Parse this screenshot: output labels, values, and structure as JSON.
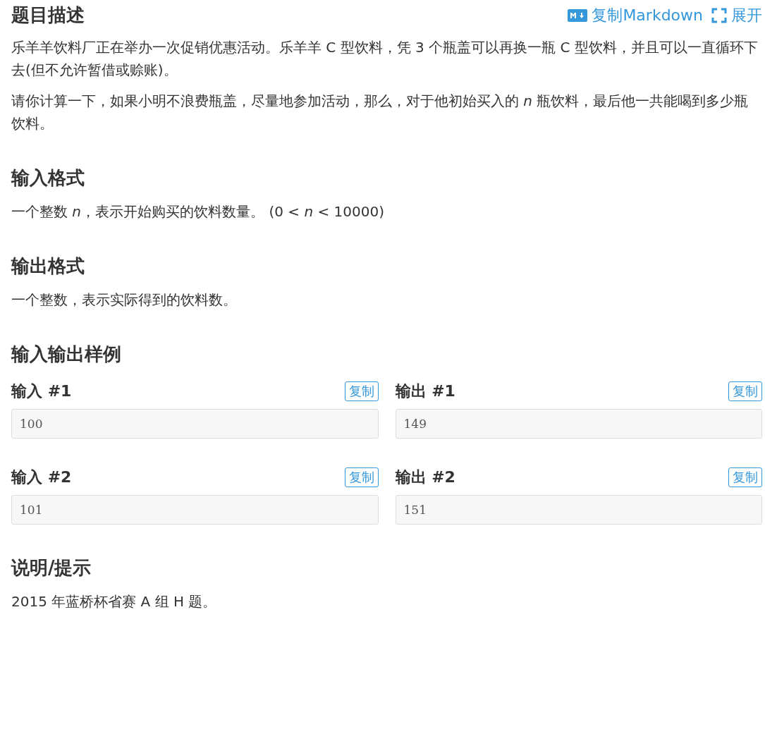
{
  "header": {
    "title": "题目描述",
    "actions": [
      {
        "kind": "markdown",
        "label": "复制Markdown"
      },
      {
        "kind": "expand",
        "label": "展开"
      }
    ]
  },
  "description": [
    "乐羊羊饮料厂正在举办一次促销优惠活动。乐羊羊 C 型饮料，凭 3 个瓶盖可以再换一瓶 C 型饮料，并且可以一直循环下去(但不允许暂借或赊账)。",
    "请你计算一下，如果小明不浪费瓶盖，尽量地参加活动，那么，对于他初始买入的 *n* 瓶饮料，最后他一共能喝到多少瓶饮料。"
  ],
  "input_format": {
    "title": "输入格式",
    "text": "一个整数 *n*，表示开始购买的饮料数量。 (0 < *n* < 10000)"
  },
  "output_format": {
    "title": "输出格式",
    "text": "一个整数，表示实际得到的饮料数。"
  },
  "samples": {
    "title": "输入输出样例",
    "items": [
      {
        "input": {
          "label": "输入 #1",
          "copy": "复制",
          "value": "100"
        },
        "output": {
          "label": "输出 #1",
          "copy": "复制",
          "value": "149"
        }
      },
      {
        "input": {
          "label": "输入 #2",
          "copy": "复制",
          "value": "101"
        },
        "output": {
          "label": "输出 #2",
          "copy": "复制",
          "value": "151"
        }
      }
    ]
  },
  "hint": {
    "title": "说明/提示",
    "text": "2015 年蓝桥杯省赛 A 组 H 题。"
  }
}
